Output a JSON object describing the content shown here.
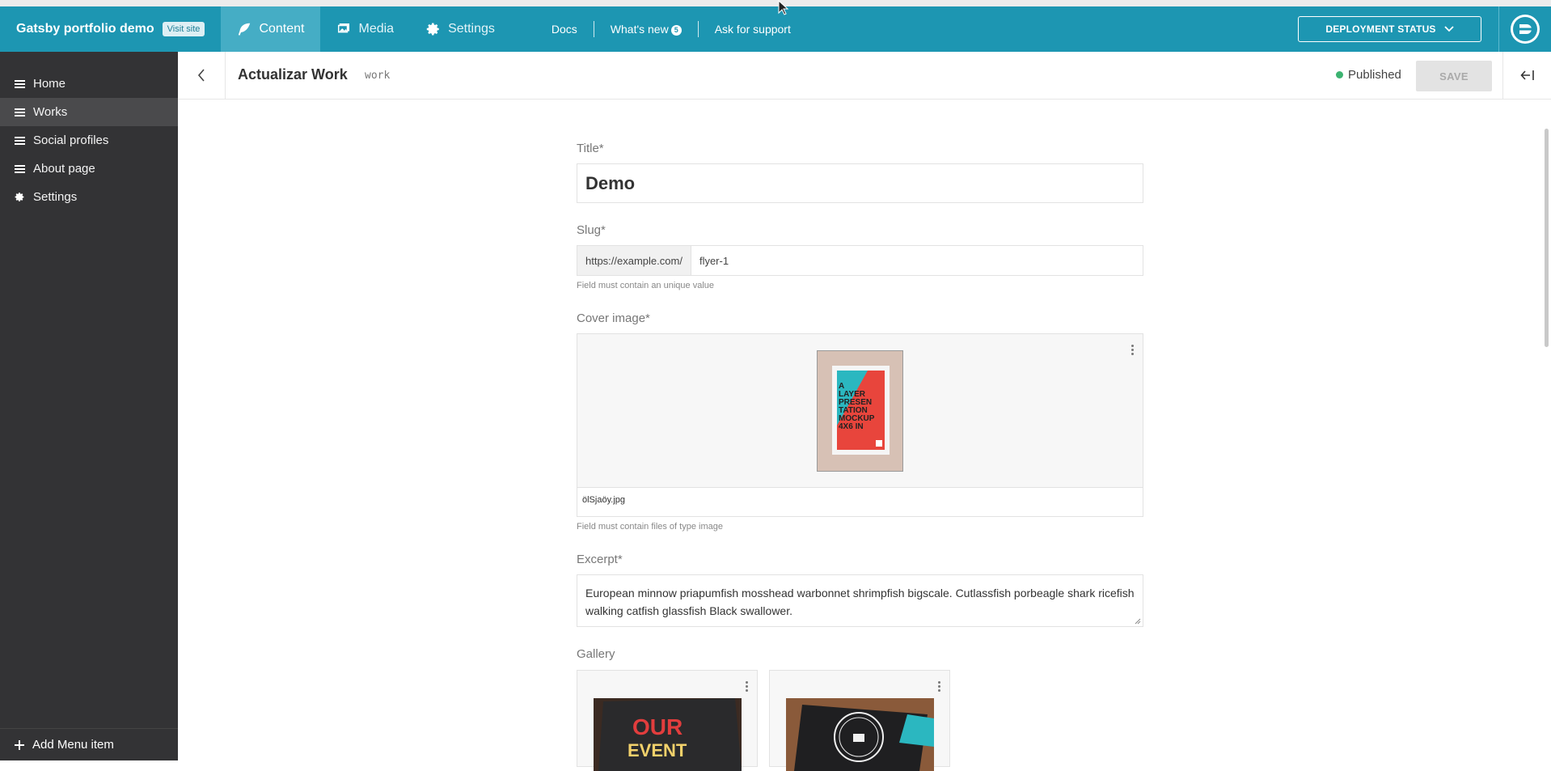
{
  "header": {
    "site_name": "Gatsby portfolio demo",
    "visit_site": "Visit site",
    "tabs": [
      {
        "label": "Content",
        "icon": "feather-icon"
      },
      {
        "label": "Media",
        "icon": "images-icon"
      },
      {
        "label": "Settings",
        "icon": "gear-icon"
      }
    ],
    "links": {
      "docs": "Docs",
      "whats_new": "What's new",
      "whats_new_count": "5",
      "support": "Ask for support"
    },
    "deployment_status": "DEPLOYMENT STATUS",
    "accent_color": "#1d96b2"
  },
  "sidebar": {
    "items": [
      {
        "label": "Home"
      },
      {
        "label": "Works"
      },
      {
        "label": "Social profiles"
      },
      {
        "label": "About page"
      },
      {
        "label": "Settings"
      }
    ],
    "add_menu_item": "Add Menu item"
  },
  "editor": {
    "title": "Actualizar Work",
    "model": "work",
    "status": "Published",
    "save_label": "SAVE"
  },
  "form": {
    "title_label": "Title*",
    "title_value": "Demo",
    "slug_label": "Slug*",
    "slug_prefix": "https://example.com/",
    "slug_value": "flyer-1",
    "slug_hint": "Field must contain an unique value",
    "cover_label": "Cover image*",
    "cover_filename": "ölSjaöy.jpg",
    "cover_hint": "Field must contain files of type image",
    "excerpt_label": "Excerpt*",
    "excerpt_value": "European minnow priapumfish mosshead warbonnet shrimpfish bigscale. Cutlassfish porbeagle shark ricefish walking catfish glassfish Black swallower.",
    "gallery_label": "Gallery"
  }
}
